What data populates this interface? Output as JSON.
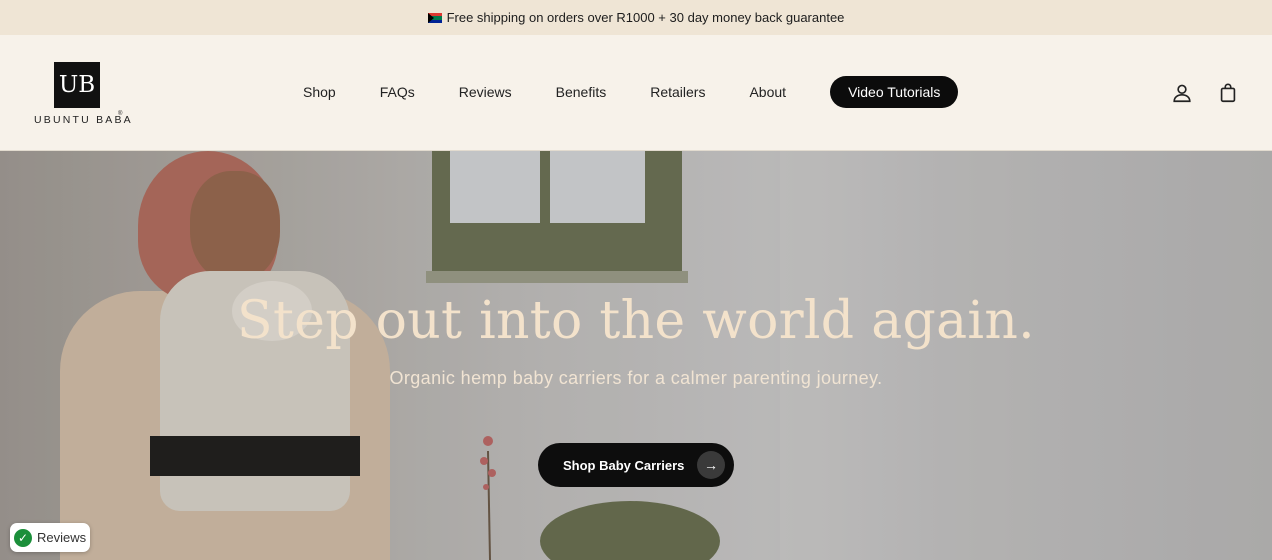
{
  "announcement": {
    "flag_icon": "south-africa-flag-icon",
    "text": "Free shipping on orders over R1000 + 30 day money back guarantee"
  },
  "header": {
    "logo": {
      "mark": "UB",
      "wordmark": "UBUNTU BABA",
      "registered": "®"
    },
    "nav": [
      {
        "label": "Shop"
      },
      {
        "label": "FAQs"
      },
      {
        "label": "Reviews"
      },
      {
        "label": "Benefits"
      },
      {
        "label": "Retailers"
      },
      {
        "label": "About"
      }
    ],
    "cta_nav": "Video Tutorials",
    "icons": [
      "account-icon",
      "cart-bag-icon"
    ]
  },
  "hero": {
    "title": "Step out into the world again.",
    "subtitle": "Organic hemp baby carriers for a calmer parenting journey.",
    "button_label": "Shop Baby Carriers",
    "button_icon": "arrow-right-icon"
  },
  "reviews_badge": {
    "label": "Reviews",
    "icon": "check-circle-icon"
  }
}
